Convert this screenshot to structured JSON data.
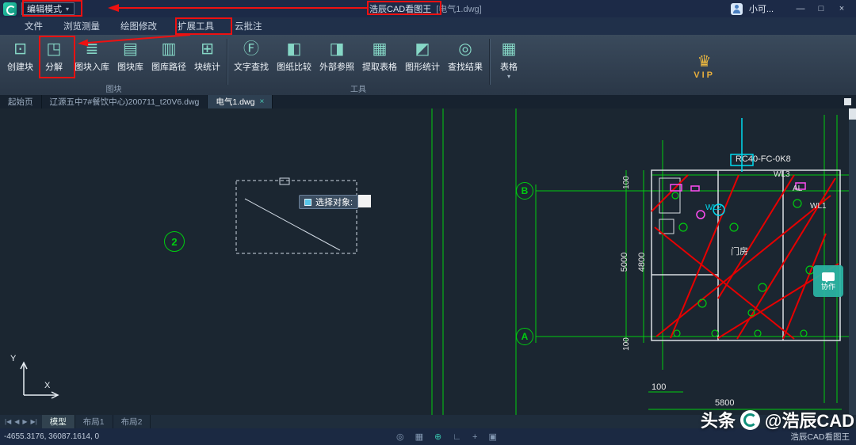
{
  "titlebar": {
    "mode_dropdown": {
      "label": "编辑模式",
      "caret": "▾"
    },
    "app_title": "浩辰CAD看图王",
    "doc_title": "[电气1.dwg]",
    "user_name": "小可...",
    "window": {
      "minimize": "—",
      "maximize": "□",
      "close": "×"
    }
  },
  "menubar": {
    "items": [
      {
        "label": "文件"
      },
      {
        "label": "浏览测量"
      },
      {
        "label": "绘图修改"
      },
      {
        "label": "扩展工具"
      },
      {
        "label": "云批注"
      }
    ]
  },
  "ribbon": {
    "group1": {
      "label": "图块",
      "buttons": [
        {
          "label": "创建块",
          "icon": "⊡"
        },
        {
          "label": "分解",
          "icon": "◳"
        },
        {
          "label": "图块入库",
          "icon": "≣"
        },
        {
          "label": "图块库",
          "icon": "▤"
        },
        {
          "label": "图库路径",
          "icon": "▥"
        },
        {
          "label": "块统计",
          "icon": "⊞"
        }
      ]
    },
    "group2": {
      "label": "工具",
      "buttons": [
        {
          "label": "文字查找",
          "icon": "Ⓕ"
        },
        {
          "label": "图纸比较",
          "icon": "◧"
        },
        {
          "label": "外部参照",
          "icon": "◨"
        },
        {
          "label": "提取表格",
          "icon": "▦"
        },
        {
          "label": "图形统计",
          "icon": "◩"
        },
        {
          "label": "查找结果",
          "icon": "◎"
        }
      ]
    },
    "table_button": {
      "label": "表格",
      "icon": "▦",
      "caret": "▾"
    },
    "vip": {
      "label": "VIP",
      "icon": "♛"
    }
  },
  "doctabs": [
    {
      "label": "起始页"
    },
    {
      "label": "辽源五中7#餐饮中心)200711_t20V6.dwg"
    },
    {
      "label": "电气1.dwg",
      "close": "×"
    }
  ],
  "canvas": {
    "grid_bubbles": {
      "b2": "2",
      "bB": "B",
      "bA": "A"
    },
    "tooltip": {
      "label": "选择对象:"
    },
    "labels": {
      "panel_code": "RC40-FC-0K8",
      "wl3": "WL3",
      "al": "AL",
      "wl1": "WL1",
      "wl2": "WL2",
      "room": "门房",
      "dim_5000": "5000",
      "dim_4800": "4800",
      "dim_100_top": "100",
      "dim_100_bottom": "100",
      "dim_100_h": "100",
      "dim_5800": "5800"
    },
    "collab_button": {
      "label": "协作"
    },
    "ucs": {
      "x": "X",
      "y": "Y"
    }
  },
  "layoutbar": {
    "nav": [
      "|◀",
      "◀",
      "▶",
      "▶|"
    ],
    "tabs": [
      {
        "label": "模型"
      },
      {
        "label": "布局1"
      },
      {
        "label": "布局2"
      }
    ]
  },
  "statusbar": {
    "coords": "-4655.3176, 36087.1614, 0",
    "icons": [
      "◎",
      "▦",
      "⊕",
      "∟",
      "+",
      "▣"
    ],
    "right_label": "浩辰CAD看图王"
  },
  "watermark": {
    "prefix": "头条",
    "handle": "@浩辰CAD"
  }
}
